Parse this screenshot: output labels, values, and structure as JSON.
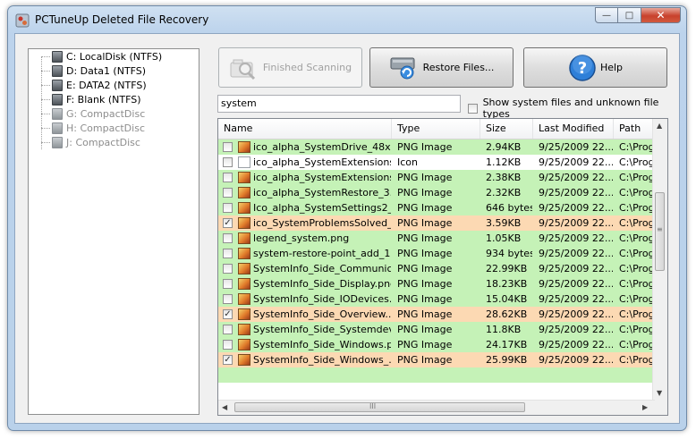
{
  "window": {
    "title": "PCTuneUp Deleted File Recovery",
    "min_symbol": "—",
    "max_symbol": "□",
    "close_symbol": "✕"
  },
  "drives": [
    {
      "label": "C: LocalDisk (NTFS)",
      "enabled": true
    },
    {
      "label": "D: Data1 (NTFS)",
      "enabled": true
    },
    {
      "label": "E: DATA2 (NTFS)",
      "enabled": true
    },
    {
      "label": "F: Blank (NTFS)",
      "enabled": true
    },
    {
      "label": "G: CompactDisc",
      "enabled": false
    },
    {
      "label": "H: CompactDisc",
      "enabled": false
    },
    {
      "label": "J: CompactDisc",
      "enabled": false
    }
  ],
  "toolbar": {
    "scan_label": "Finished Scanning",
    "restore_label": "Restore Files...",
    "help_label": "Help"
  },
  "search": {
    "value": "system"
  },
  "show_system": {
    "label": "Show system files and unknown file types",
    "checked": false
  },
  "columns": [
    "Name",
    "Type",
    "Size",
    "Last Modified",
    "Path"
  ],
  "files": [
    {
      "name": "ico_alpha_SystemDrive_48x4...",
      "type": "PNG Image",
      "size": "2.94KB",
      "modified": "9/25/2009 22...",
      "path": "C:\\Prog",
      "checked": false,
      "status": "green",
      "icon": "image"
    },
    {
      "name": "ico_alpha_SystemExtensions...",
      "type": "Icon",
      "size": "1.12KB",
      "modified": "9/25/2009 22...",
      "path": "C:\\Prog",
      "checked": false,
      "status": "none",
      "icon": "plain"
    },
    {
      "name": "ico_alpha_SystemExtensions...",
      "type": "PNG Image",
      "size": "2.38KB",
      "modified": "9/25/2009 22...",
      "path": "C:\\Prog",
      "checked": false,
      "status": "green",
      "icon": "image"
    },
    {
      "name": "ico_alpha_SystemRestore_3...",
      "type": "PNG Image",
      "size": "2.32KB",
      "modified": "9/25/2009 22...",
      "path": "C:\\Prog",
      "checked": false,
      "status": "green",
      "icon": "image"
    },
    {
      "name": "Ico_alpha_SystemSettings2_...",
      "type": "PNG Image",
      "size": "646 bytes",
      "modified": "9/25/2009 22...",
      "path": "C:\\Prog",
      "checked": false,
      "status": "green",
      "icon": "image"
    },
    {
      "name": "ico_SystemProblemsSolved_2...",
      "type": "PNG Image",
      "size": "3.59KB",
      "modified": "9/25/2009 22...",
      "path": "C:\\Prog",
      "checked": true,
      "status": "orange",
      "icon": "image"
    },
    {
      "name": "legend_system.png",
      "type": "PNG Image",
      "size": "1.05KB",
      "modified": "9/25/2009 22...",
      "path": "C:\\Prog",
      "checked": false,
      "status": "green",
      "icon": "image"
    },
    {
      "name": "system-restore-point_add_1...",
      "type": "PNG Image",
      "size": "934 bytes",
      "modified": "9/25/2009 22...",
      "path": "C:\\Prog",
      "checked": false,
      "status": "green",
      "icon": "image"
    },
    {
      "name": "SystemInfo_Side_Communica...",
      "type": "PNG Image",
      "size": "22.99KB",
      "modified": "9/25/2009 22...",
      "path": "C:\\Prog",
      "checked": false,
      "status": "green",
      "icon": "image"
    },
    {
      "name": "SystemInfo_Side_Display.png",
      "type": "PNG Image",
      "size": "18.23KB",
      "modified": "9/25/2009 22...",
      "path": "C:\\Prog",
      "checked": false,
      "status": "green",
      "icon": "image"
    },
    {
      "name": "SystemInfo_Side_IODevices....",
      "type": "PNG Image",
      "size": "15.04KB",
      "modified": "9/25/2009 22...",
      "path": "C:\\Prog",
      "checked": false,
      "status": "green",
      "icon": "image"
    },
    {
      "name": "SystemInfo_Side_Overview....",
      "type": "PNG Image",
      "size": "28.62KB",
      "modified": "9/25/2009 22...",
      "path": "C:\\Prog",
      "checked": true,
      "status": "orange",
      "icon": "image"
    },
    {
      "name": "SystemInfo_Side_Systemdev...",
      "type": "PNG Image",
      "size": "11.8KB",
      "modified": "9/25/2009 22...",
      "path": "C:\\Prog",
      "checked": false,
      "status": "green",
      "icon": "image"
    },
    {
      "name": "SystemInfo_Side_Windows.png",
      "type": "PNG Image",
      "size": "24.17KB",
      "modified": "9/25/2009 22...",
      "path": "C:\\Prog",
      "checked": false,
      "status": "green",
      "icon": "image"
    },
    {
      "name": "SystemInfo_Side_Windows_...",
      "type": "PNG Image",
      "size": "25.99KB",
      "modified": "9/25/2009 22...",
      "path": "C:\\Prog",
      "checked": true,
      "status": "orange",
      "icon": "image"
    }
  ],
  "scrollbars": {
    "up": "▲",
    "down": "▼",
    "left": "◀",
    "right": "▶",
    "grip": "≡",
    "hgrip": "III"
  }
}
